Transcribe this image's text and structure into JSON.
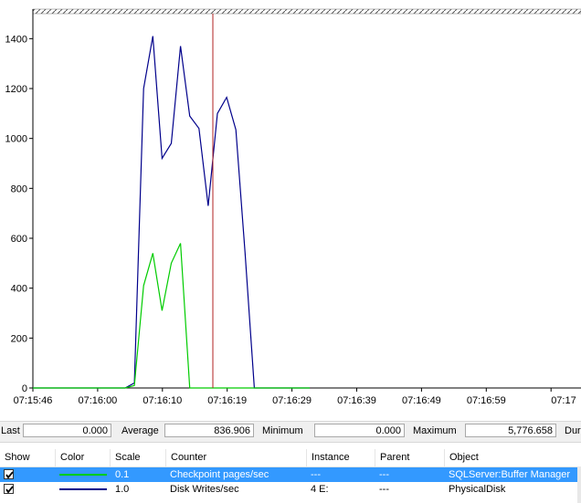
{
  "chart_data": {
    "type": "line",
    "x_tick_labels": [
      "07:15:46",
      "07:16:00",
      "07:16:10",
      "07:16:19",
      "07:16:29",
      "07:16:39",
      "07:16:49",
      "07:16:59",
      "07:17"
    ],
    "y_ticks": [
      0,
      200,
      400,
      600,
      800,
      1000,
      1200,
      1400
    ],
    "ylim": [
      0,
      1500
    ],
    "grid": false,
    "legend": "none",
    "current_time_marker_color": "#b22222",
    "series": [
      {
        "name": "Disk Writes/sec",
        "color": "#00008b",
        "points": [
          [
            0,
            0
          ],
          [
            1,
            0
          ],
          [
            2,
            0
          ],
          [
            3,
            0
          ],
          [
            4,
            0
          ],
          [
            5,
            0
          ],
          [
            6,
            0
          ],
          [
            7,
            0
          ],
          [
            8,
            0
          ],
          [
            9,
            0
          ],
          [
            10,
            0
          ],
          [
            11,
            20
          ],
          [
            12,
            1200
          ],
          [
            13,
            1410
          ],
          [
            14,
            920
          ],
          [
            15,
            980
          ],
          [
            16,
            1370
          ],
          [
            17,
            1090
          ],
          [
            18,
            1040
          ],
          [
            19,
            730
          ],
          [
            20,
            1100
          ],
          [
            21,
            1165
          ],
          [
            22,
            1035
          ],
          [
            23,
            540
          ],
          [
            24,
            0
          ],
          [
            25,
            0
          ],
          [
            26,
            0
          ],
          [
            27,
            0
          ],
          [
            28,
            0
          ],
          [
            29,
            0
          ],
          [
            30,
            0
          ]
        ]
      },
      {
        "name": "Checkpoint pages/sec",
        "color": "#00cc00",
        "points": [
          [
            0,
            0
          ],
          [
            1,
            0
          ],
          [
            2,
            0
          ],
          [
            3,
            0
          ],
          [
            4,
            0
          ],
          [
            5,
            0
          ],
          [
            6,
            0
          ],
          [
            7,
            0
          ],
          [
            8,
            0
          ],
          [
            9,
            0
          ],
          [
            10,
            0
          ],
          [
            11,
            10
          ],
          [
            12,
            410
          ],
          [
            13,
            540
          ],
          [
            14,
            310
          ],
          [
            15,
            500
          ],
          [
            16,
            580
          ],
          [
            17,
            0
          ],
          [
            18,
            0
          ],
          [
            19,
            0
          ],
          [
            20,
            0
          ],
          [
            21,
            0
          ],
          [
            22,
            0
          ],
          [
            23,
            0
          ],
          [
            24,
            0
          ],
          [
            25,
            0
          ],
          [
            26,
            0
          ],
          [
            27,
            0
          ],
          [
            28,
            0
          ],
          [
            29,
            0
          ],
          [
            30,
            0
          ]
        ]
      }
    ]
  },
  "stats": {
    "last_label": "Last",
    "last_value": "0.000",
    "average_label": "Average",
    "average_value": "836.906",
    "minimum_label": "Minimum",
    "minimum_value": "0.000",
    "maximum_label": "Maximum",
    "maximum_value": "5,776.658",
    "duration_label": "Dur"
  },
  "counter_list": {
    "columns": [
      "Show",
      "Color",
      "Scale",
      "Counter",
      "Instance",
      "Parent",
      "Object"
    ],
    "rows": [
      {
        "show": true,
        "color": "#00cc00",
        "scale": "0.1",
        "counter": "Checkpoint pages/sec",
        "instance": "---",
        "parent": "---",
        "object": "SQLServer:Buffer Manager",
        "selected": true
      },
      {
        "show": true,
        "color": "#00008b",
        "scale": "1.0",
        "counter": "Disk Writes/sec",
        "instance": "4 E:",
        "parent": "---",
        "object": "PhysicalDisk",
        "selected": false
      }
    ]
  }
}
